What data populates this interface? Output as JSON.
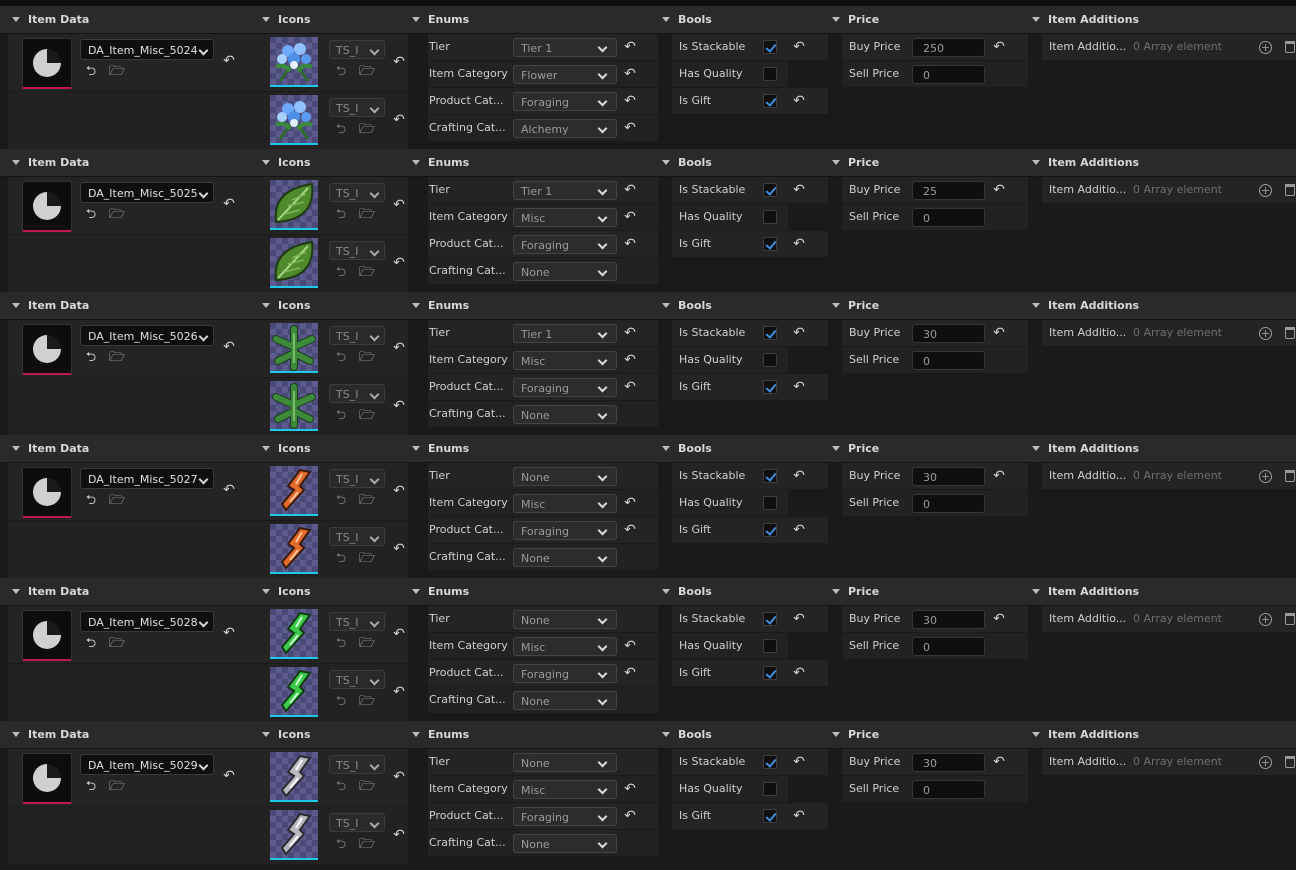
{
  "headers": {
    "item_data": "Item Data",
    "icons": "Icons",
    "enums": "Enums",
    "bools": "Bools",
    "price": "Price",
    "item_additions": "Item Additions"
  },
  "field_labels": {
    "tier": "Tier",
    "item_category": "Item Category",
    "product_category": "Product Cat...",
    "crafting_category": "Crafting Cat...",
    "is_stackable": "Is Stackable",
    "has_quality": "Has Quality",
    "is_gift": "Is Gift",
    "buy_price": "Buy Price",
    "sell_price": "Sell Price",
    "item_additions": "Item Additio...",
    "array_elements": "0 Array element"
  },
  "texture_placeholder": "TS_I",
  "rows": [
    {
      "asset": "DA_Item_Misc_5024",
      "icon": "blue-flower",
      "tier": "Tier 1",
      "item_category": "Flower",
      "product_category": "Foraging",
      "crafting_category": "Alchemy",
      "is_stackable": true,
      "has_quality": false,
      "is_gift": true,
      "buy_price": "250",
      "sell_price": "0"
    },
    {
      "asset": "DA_Item_Misc_5025",
      "icon": "green-leaf",
      "tier": "Tier 1",
      "item_category": "Misc",
      "product_category": "Foraging",
      "crafting_category": "None",
      "is_stackable": true,
      "has_quality": false,
      "is_gift": true,
      "buy_price": "25",
      "sell_price": "0"
    },
    {
      "asset": "DA_Item_Misc_5026",
      "icon": "ivy-leaf",
      "tier": "Tier 1",
      "item_category": "Misc",
      "product_category": "Foraging",
      "crafting_category": "None",
      "is_stackable": true,
      "has_quality": false,
      "is_gift": true,
      "buy_price": "30",
      "sell_price": "0"
    },
    {
      "asset": "DA_Item_Misc_5027",
      "icon": "orange-crystal",
      "tier": "None",
      "item_category": "Misc",
      "product_category": "Foraging",
      "crafting_category": "None",
      "is_stackable": true,
      "has_quality": false,
      "is_gift": true,
      "buy_price": "30",
      "sell_price": "0"
    },
    {
      "asset": "DA_Item_Misc_5028",
      "icon": "green-crystal",
      "tier": "None",
      "item_category": "Misc",
      "product_category": "Foraging",
      "crafting_category": "None",
      "is_stackable": true,
      "has_quality": false,
      "is_gift": true,
      "buy_price": "30",
      "sell_price": "0"
    },
    {
      "asset": "DA_Item_Misc_5029",
      "icon": "silver-crystal",
      "tier": "None",
      "item_category": "Misc",
      "product_category": "Foraging",
      "crafting_category": "None",
      "is_stackable": true,
      "has_quality": false,
      "is_gift": true,
      "buy_price": "30",
      "sell_price": "0"
    }
  ],
  "colors": {
    "accent_underline": "#c0174e",
    "texture_underline": "#1ec8e8",
    "checkbox": "#3f8fe0"
  }
}
